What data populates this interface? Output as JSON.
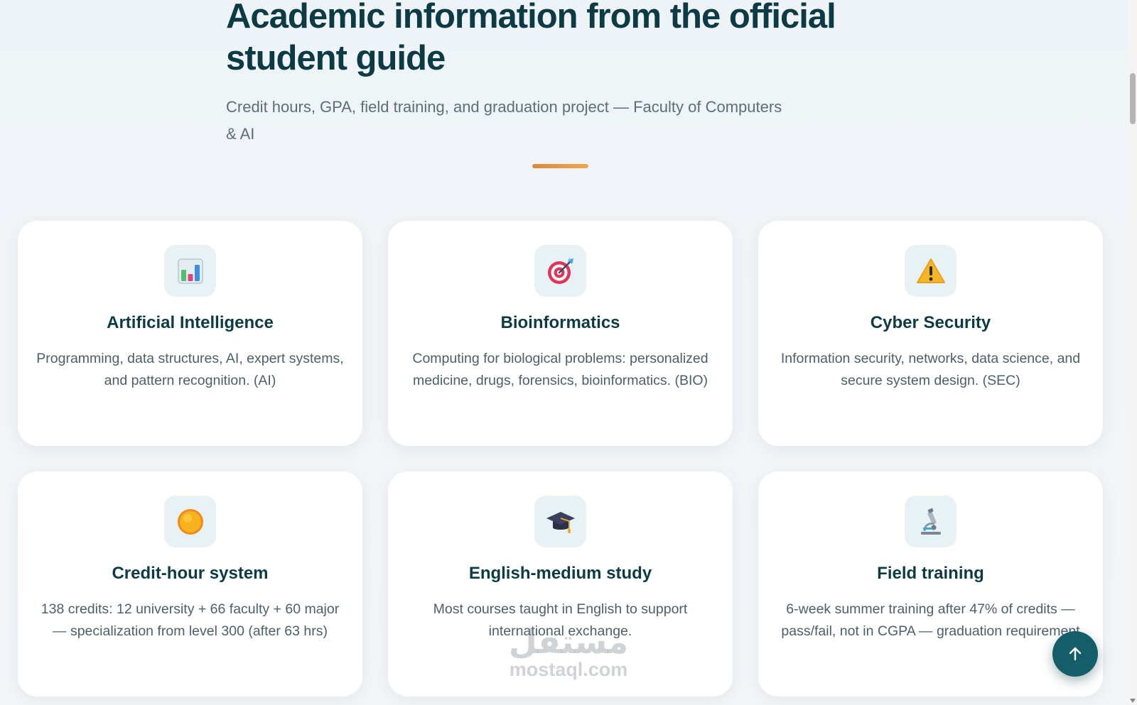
{
  "header": {
    "title": "Academic information from the official student guide",
    "subtitle": "Credit hours, GPA, field training, and graduation project — Faculty of Computers & AI"
  },
  "cards": [
    {
      "icon": "bar-chart-icon",
      "title": "Artificial Intelligence",
      "description": "Programming, data structures, AI, expert systems, and pattern recognition. (AI)"
    },
    {
      "icon": "target-icon",
      "title": "Bioinformatics",
      "description": "Computing for biological problems: personalized medicine, drugs, forensics, bioinformatics. (BIO)"
    },
    {
      "icon": "warning-icon",
      "title": "Cyber Security",
      "description": "Information security, networks, data science, and secure system design. (SEC)"
    },
    {
      "icon": "sun-icon",
      "title": "Credit-hour system",
      "description": "138 credits: 12 university + 66 faculty + 60 major — specialization from level 300 (after 63 hrs)"
    },
    {
      "icon": "graduation-cap-icon",
      "title": "English-medium study",
      "description": "Most courses taught in English to support international exchange."
    },
    {
      "icon": "microscope-icon",
      "title": "Field training",
      "description": "6-week summer training after 47% of credits — pass/fail, not in CGPA — graduation requirement"
    }
  ],
  "back_to_top": {
    "icon": "arrow-up-icon"
  },
  "watermark": {
    "arabic": "مستقل",
    "latin": "mostaql.com"
  },
  "colors": {
    "heading": "#0d3b45",
    "body_text": "#4d5f68",
    "accent": "#e9963f",
    "fab": "#135e68",
    "icon_box": "#e8f1f3"
  }
}
